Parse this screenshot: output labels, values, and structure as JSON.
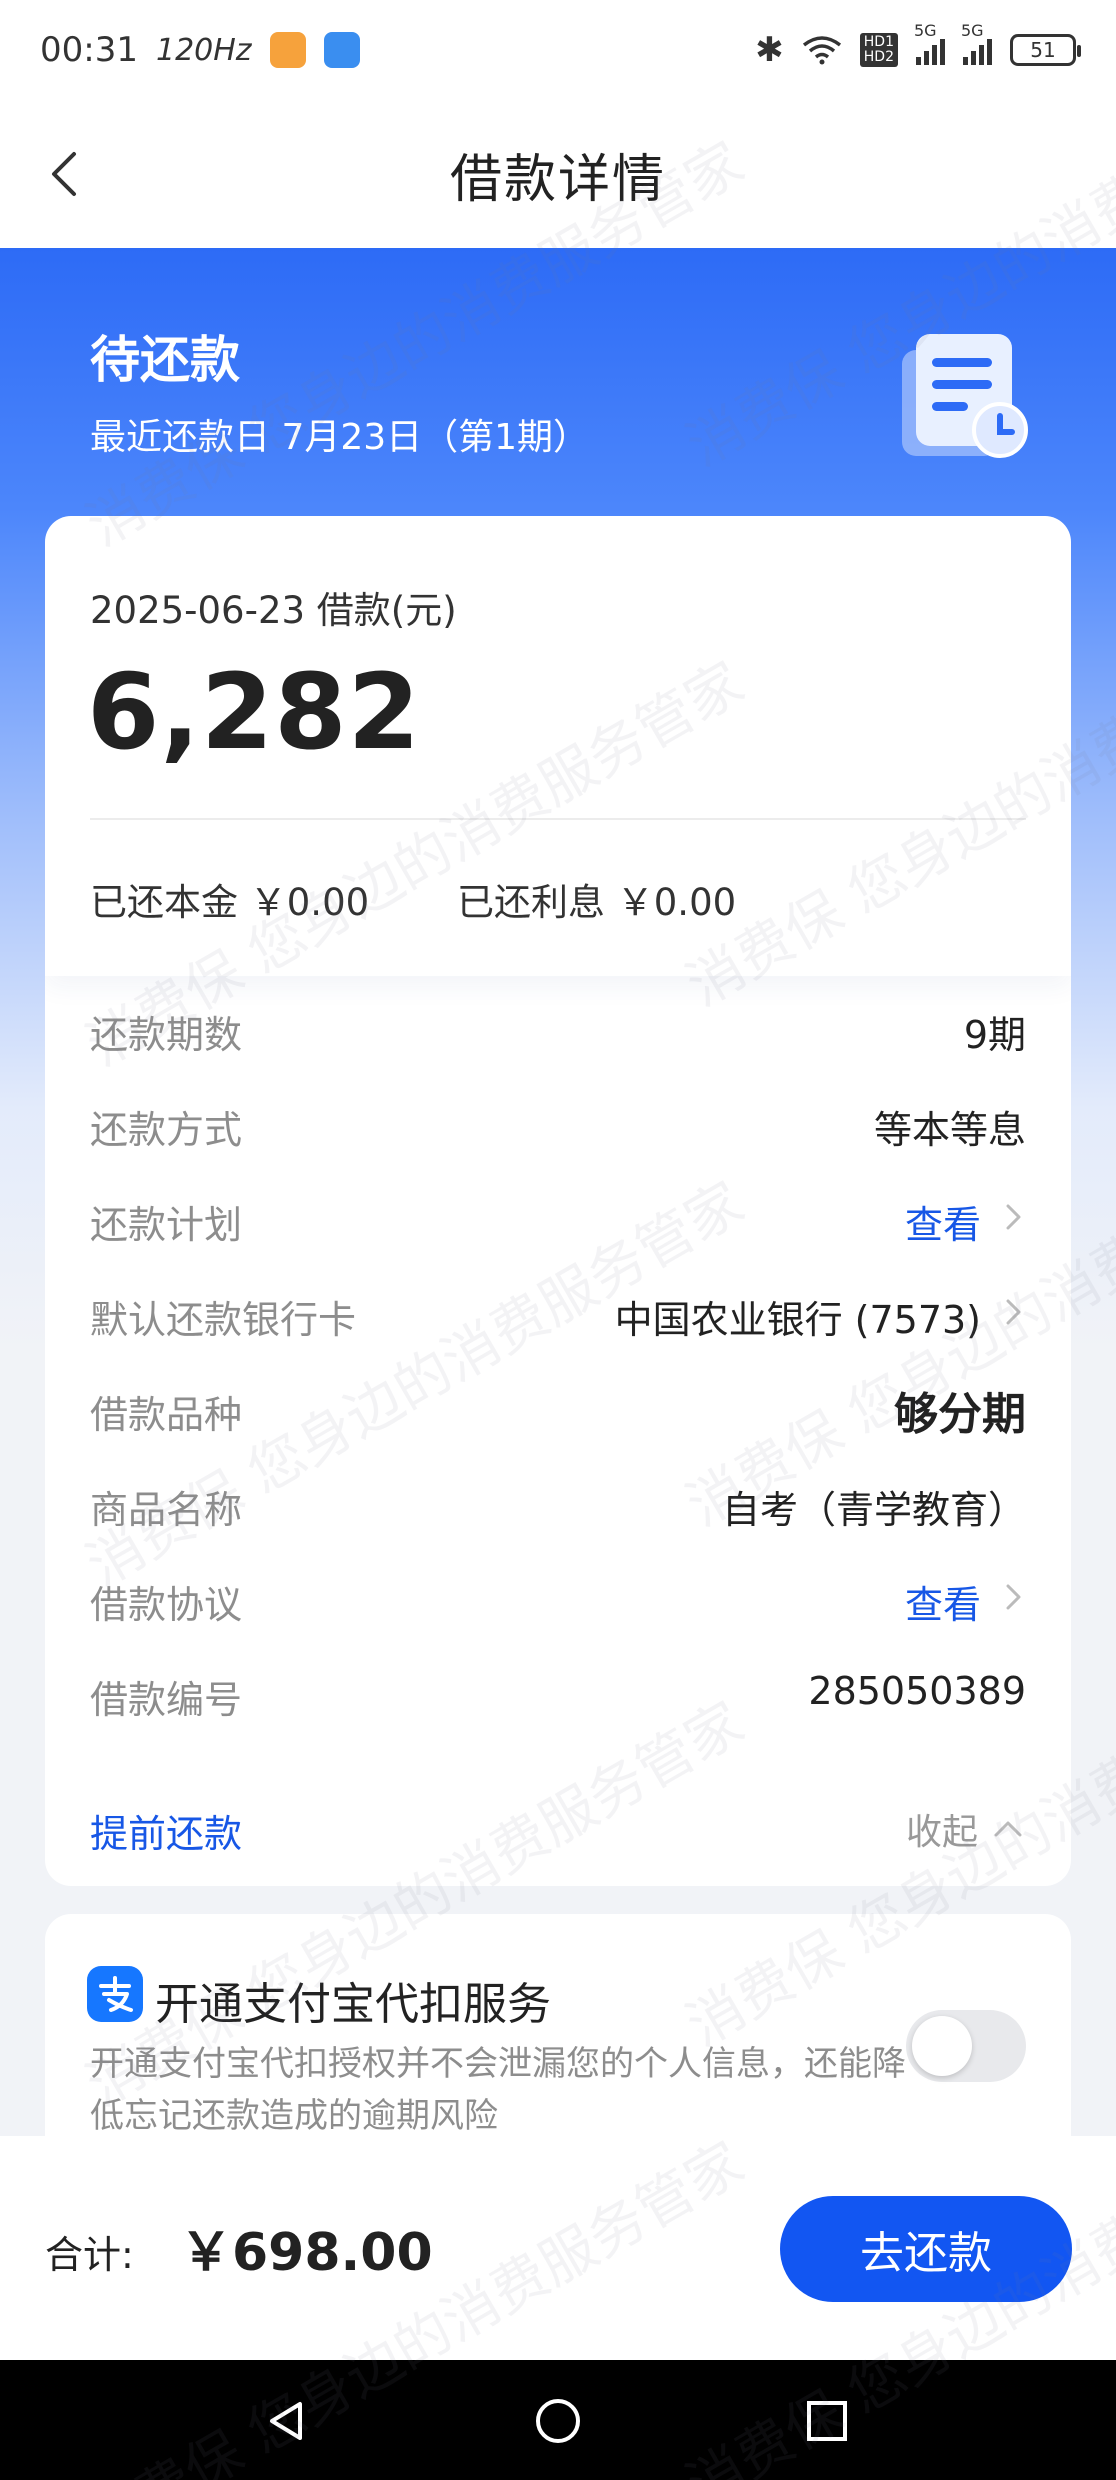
{
  "status_bar": {
    "time": "00:31",
    "refresh_rate": "120Hz",
    "network_1": "5G",
    "network_2": "5G",
    "hd_label_1": "HD1",
    "hd_label_2": "HD2",
    "battery": "51"
  },
  "nav": {
    "title": "借款详情"
  },
  "hero": {
    "status": "待还款",
    "next_due": "最近还款日 7月23日（第1期）"
  },
  "loan": {
    "label": "2025-06-23 借款(元)",
    "amount": "6,282",
    "repaid_principal": "已还本金 ￥0.00",
    "repaid_interest": "已还利息 ￥0.00"
  },
  "details": [
    {
      "label": "还款期数",
      "value": "9期"
    },
    {
      "label": "还款方式",
      "value": "等本等息"
    },
    {
      "label": "还款计划",
      "value": "查看"
    },
    {
      "label": "默认还款银行卡",
      "value": "中国农业银行 (7573)"
    },
    {
      "label": "借款品种",
      "value": "够分期"
    },
    {
      "label": "商品名称",
      "value": "自考（青学教育）"
    },
    {
      "label": "借款协议",
      "value": "查看"
    },
    {
      "label": "借款编号",
      "value": "285050389"
    }
  ],
  "actions": {
    "prepay": "提前还款",
    "collapse": "收起"
  },
  "alipay": {
    "title": "开通支付宝代扣服务",
    "description": "开通支付宝代扣授权并不会泄漏您的个人信息，还能降低忘记还款造成的逾期风险",
    "enabled": false
  },
  "footer": {
    "total_label": "合计:",
    "total_amount": "￥698.00",
    "repay_button": "去还款"
  },
  "watermark": "消费保 您身边的消费服务管家",
  "colors": {
    "primary": "#1256f2",
    "link": "#1757e6",
    "hero_top": "#2d6bf6"
  }
}
